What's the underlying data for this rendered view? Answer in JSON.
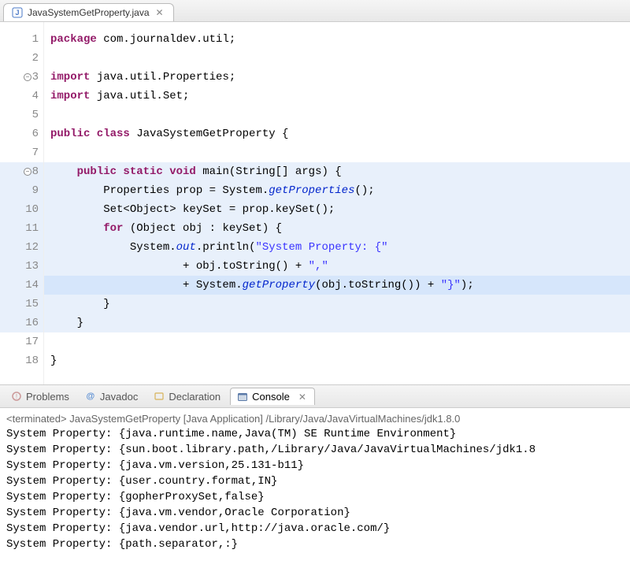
{
  "editor_tab": {
    "filename": "JavaSystemGetProperty.java"
  },
  "code": {
    "lines": [
      {
        "n": 1,
        "hl": false,
        "fold": false,
        "segments": [
          [
            "kw",
            "package "
          ],
          [
            "pkg",
            "com.journaldev.util;"
          ]
        ]
      },
      {
        "n": 2,
        "hl": false,
        "fold": false,
        "segments": []
      },
      {
        "n": 3,
        "hl": false,
        "fold": true,
        "segments": [
          [
            "kw",
            "import "
          ],
          [
            "pkg",
            "java.util.Properties;"
          ]
        ]
      },
      {
        "n": 4,
        "hl": false,
        "fold": false,
        "segments": [
          [
            "kw",
            "import "
          ],
          [
            "pkg",
            "java.util.Set;"
          ]
        ]
      },
      {
        "n": 5,
        "hl": false,
        "fold": false,
        "segments": []
      },
      {
        "n": 6,
        "hl": false,
        "fold": false,
        "segments": [
          [
            "kw",
            "public class "
          ],
          [
            "type",
            "JavaSystemGetProperty {"
          ]
        ]
      },
      {
        "n": 7,
        "hl": false,
        "fold": false,
        "segments": []
      },
      {
        "n": 8,
        "hl": true,
        "fold": true,
        "segments": [
          [
            "plain",
            "    "
          ],
          [
            "kw",
            "public static void "
          ],
          [
            "method-decl",
            "main(String[] args) {"
          ]
        ]
      },
      {
        "n": 9,
        "hl": true,
        "fold": false,
        "segments": [
          [
            "plain",
            "        Properties prop = System."
          ],
          [
            "field",
            "getProperties"
          ],
          [
            "plain",
            "();"
          ]
        ]
      },
      {
        "n": 10,
        "hl": true,
        "fold": false,
        "segments": [
          [
            "plain",
            "        Set<Object> keySet = prop.keySet();"
          ]
        ]
      },
      {
        "n": 11,
        "hl": true,
        "fold": false,
        "segments": [
          [
            "plain",
            "        "
          ],
          [
            "kw",
            "for "
          ],
          [
            "plain",
            "(Object obj : keySet) {"
          ]
        ]
      },
      {
        "n": 12,
        "hl": true,
        "fold": false,
        "segments": [
          [
            "plain",
            "            System."
          ],
          [
            "field",
            "out"
          ],
          [
            "plain",
            ".println("
          ],
          [
            "str",
            "\"System Property: {\""
          ]
        ]
      },
      {
        "n": 13,
        "hl": true,
        "fold": false,
        "segments": [
          [
            "plain",
            "                    + obj.toString() + "
          ],
          [
            "str",
            "\",\""
          ]
        ]
      },
      {
        "n": 14,
        "hl": true,
        "fold": false,
        "caret": true,
        "segments": [
          [
            "plain",
            "                    + System."
          ],
          [
            "field",
            "getProperty"
          ],
          [
            "plain",
            "(obj.toString()) + "
          ],
          [
            "str",
            "\"}\""
          ],
          [
            "plain",
            ");"
          ]
        ]
      },
      {
        "n": 15,
        "hl": true,
        "fold": false,
        "segments": [
          [
            "plain",
            "        }"
          ]
        ]
      },
      {
        "n": 16,
        "hl": true,
        "fold": false,
        "segments": [
          [
            "plain",
            "    }"
          ]
        ]
      },
      {
        "n": 17,
        "hl": false,
        "fold": false,
        "segments": []
      },
      {
        "n": 18,
        "hl": false,
        "fold": false,
        "segments": [
          [
            "plain",
            "}"
          ]
        ]
      }
    ]
  },
  "bottom_tabs": {
    "problems": "Problems",
    "javadoc": "Javadoc",
    "declaration": "Declaration",
    "console": "Console"
  },
  "console": {
    "status_prefix": "<terminated>",
    "status_text": " JavaSystemGetProperty [Java Application] /Library/Java/JavaVirtualMachines/jdk1.8.0",
    "lines": [
      "System Property: {java.runtime.name,Java(TM) SE Runtime Environment}",
      "System Property: {sun.boot.library.path,/Library/Java/JavaVirtualMachines/jdk1.8",
      "System Property: {java.vm.version,25.131-b11}",
      "System Property: {user.country.format,IN}",
      "System Property: {gopherProxySet,false}",
      "System Property: {java.vm.vendor,Oracle Corporation}",
      "System Property: {java.vendor.url,http://java.oracle.com/}",
      "System Property: {path.separator,:}"
    ]
  }
}
